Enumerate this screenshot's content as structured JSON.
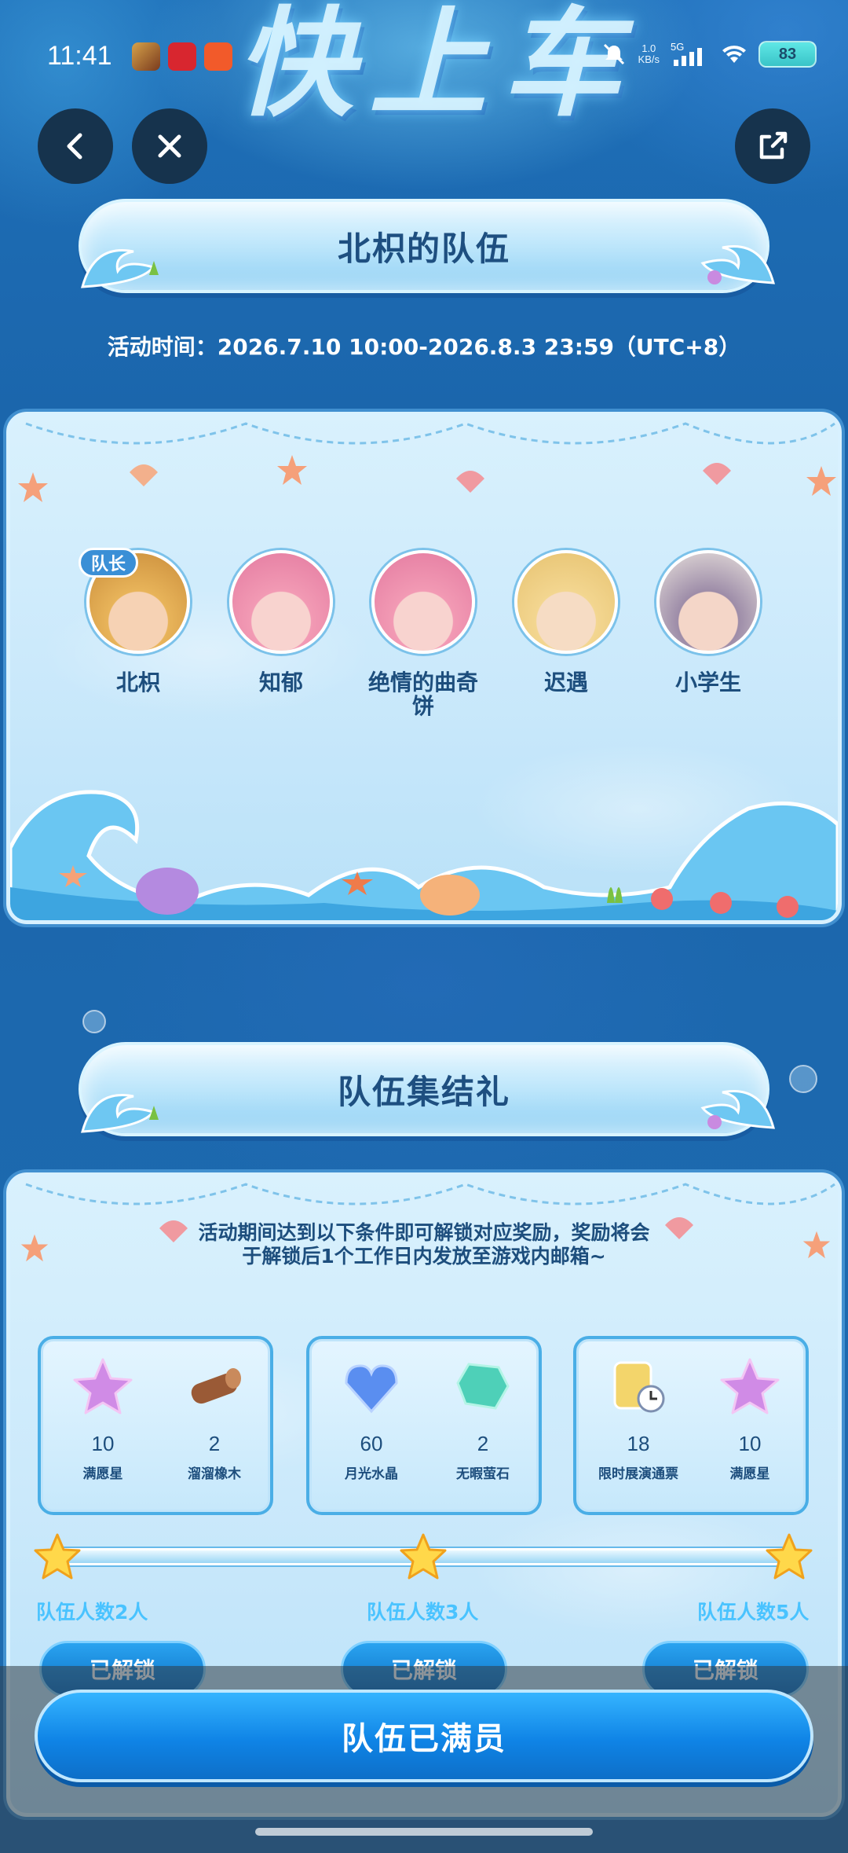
{
  "status_bar": {
    "time": "11:41",
    "net_speed_value": "1.0",
    "net_speed_unit": "KB/s",
    "network_type": "5G",
    "battery": "83"
  },
  "banner": {
    "text": "快上车"
  },
  "nav": {
    "back_icon": "chevron-left-icon",
    "close_icon": "close-icon",
    "share_icon": "share-icon"
  },
  "team": {
    "title": "北枳的队伍",
    "activity_time": "活动时间：2026.7.10 10:00-2026.8.3 23:59（UTC+8）",
    "captain_badge": "队长",
    "members": [
      {
        "name": "北枳"
      },
      {
        "name": "知郁"
      },
      {
        "name": "绝情的曲奇\n饼"
      },
      {
        "name": "迟遇"
      },
      {
        "name": "小学生"
      }
    ]
  },
  "rally": {
    "title": "队伍集结礼",
    "intro_line1": "活动期间达到以下条件即可解锁对应奖励，奖励将会",
    "intro_line2": "于解锁后1个工作日内发放至游戏内邮箱~",
    "tiers": [
      {
        "label": "队伍人数2人",
        "button": "已解锁",
        "rewards": [
          {
            "count": "10",
            "name": "满愿星"
          },
          {
            "count": "2",
            "name": "溜溜橡木"
          }
        ]
      },
      {
        "label": "队伍人数3人",
        "button": "已解锁",
        "rewards": [
          {
            "count": "60",
            "name": "月光水晶"
          },
          {
            "count": "2",
            "name": "无暇萤石"
          }
        ]
      },
      {
        "label": "队伍人数5人",
        "button": "已解锁",
        "rewards": [
          {
            "count": "18",
            "name": "限时展演通票"
          },
          {
            "count": "10",
            "name": "满愿星"
          }
        ]
      }
    ]
  },
  "footer": {
    "main_button": "队伍已满员"
  },
  "colors": {
    "primary": "#0f84e6",
    "panel": "#cbe9fb",
    "title_text": "#1e4f80",
    "tier_label": "#49c3ff"
  }
}
